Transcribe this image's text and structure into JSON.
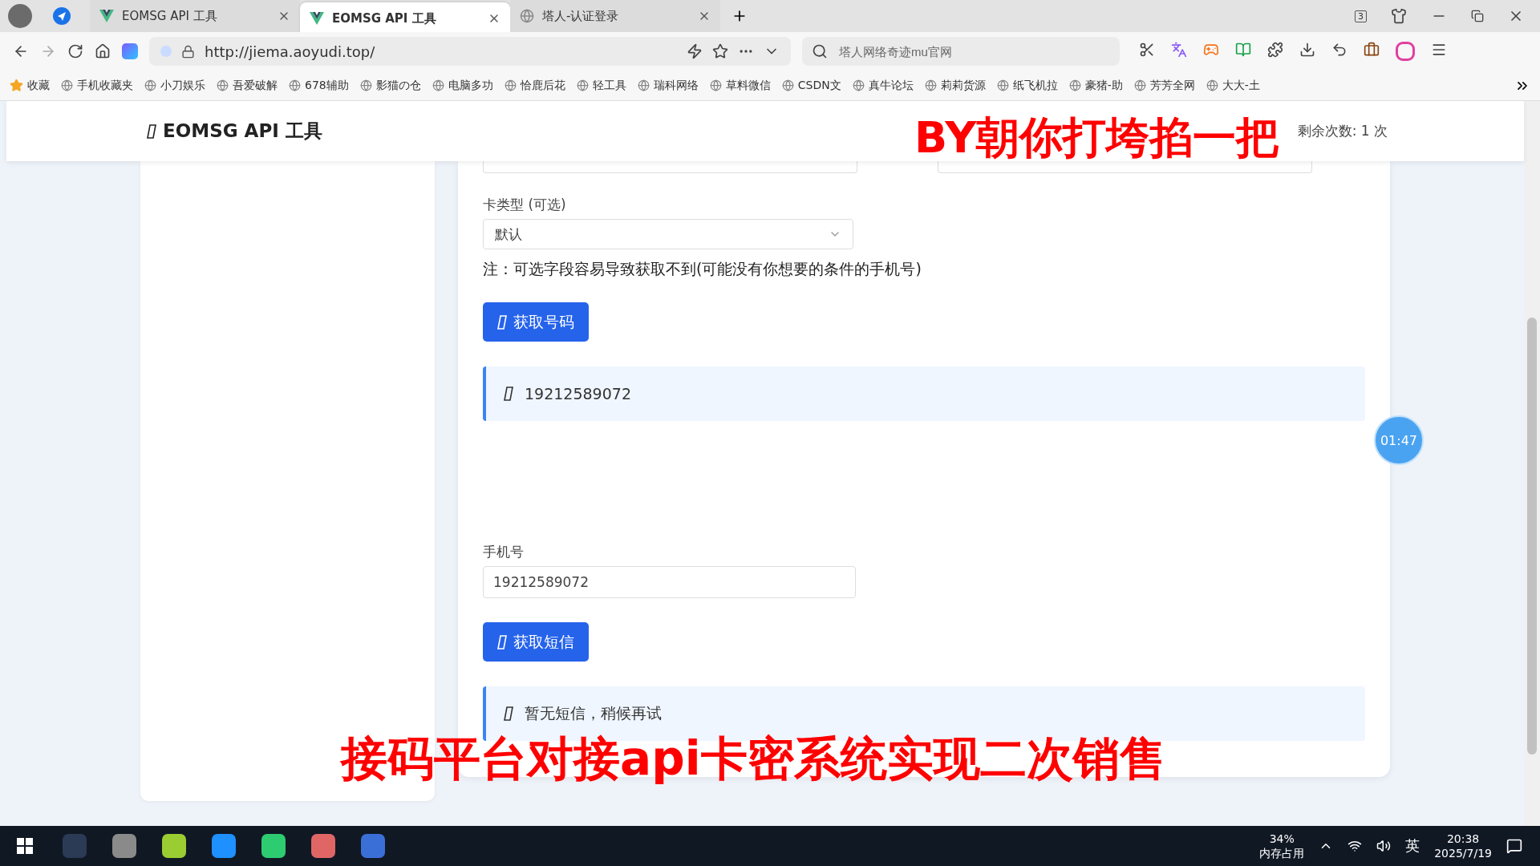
{
  "browser": {
    "tabs": [
      {
        "title": "EOMSG API 工具",
        "kind": "vue",
        "selected": false
      },
      {
        "title": "EOMSG API 工具",
        "kind": "vue",
        "selected": true
      },
      {
        "title": "塔人-认证登录",
        "kind": "globe",
        "selected": false
      }
    ],
    "tab_count": "3",
    "address": "http://jiema.aoyudi.top/",
    "search": {
      "placeholder": "塔人网络奇迹mu官网"
    },
    "bookmarks": [
      "收藏",
      "手机收藏夹",
      "小刀娱乐",
      "吾爱破解",
      "678辅助",
      "影猫の仓",
      "电脑多功",
      "恰鹿后花",
      "轻工具",
      "瑞科网络",
      "草料微信",
      "CSDN文",
      "真牛论坛",
      "莉莉货源",
      "纸飞机拉",
      "豪猪-助",
      "芳芳全网",
      "大大-土"
    ]
  },
  "page": {
    "brand": "EOMSG API 工具",
    "remaining": "剩余次数: 1 次",
    "card_type": {
      "label": "卡类型 (可选)",
      "value": "默认"
    },
    "note": "注：可选字段容易导致获取不到(可能没有你想要的条件的手机号)",
    "get_number_button": "获取号码",
    "number_result": "19212589072",
    "phone": {
      "label": "手机号",
      "value": "19212589072"
    },
    "get_sms_button": "获取短信",
    "sms_result": "暂无短信，稍候再试"
  },
  "timer": "01:47",
  "captions": [
    "BY朝你打垮掐一把",
    "接码平台对接api卡密系统实现二次销售"
  ],
  "taskbar": {
    "memory": "34%",
    "memory_label": "内存占用",
    "ime": "英",
    "time": "20:38",
    "date": "2025/7/19"
  }
}
